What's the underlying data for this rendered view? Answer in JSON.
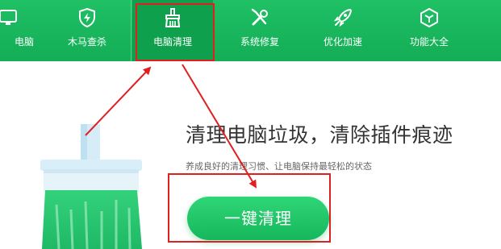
{
  "nav": {
    "items": [
      {
        "label": "电脑",
        "icon": "monitor-icon"
      },
      {
        "label": "木马查杀",
        "icon": "shield-bolt-icon"
      },
      {
        "label": "电脑清理",
        "icon": "broom-icon"
      },
      {
        "label": "系统修复",
        "icon": "wrench-screwdriver-icon"
      },
      {
        "label": "优化加速",
        "icon": "rocket-icon"
      },
      {
        "label": "功能大全",
        "icon": "cube-icon"
      }
    ],
    "active_index": 2
  },
  "main": {
    "headline": "清理电脑垃圾，清除插件痕迹",
    "subline": "养成良好的清理习惯、让电脑保持最轻松的状态",
    "clean_button_label": "一键清理"
  },
  "colors": {
    "brand_green": "#1ab45c",
    "highlight_red": "#e02020",
    "headline_text": "#333333"
  }
}
